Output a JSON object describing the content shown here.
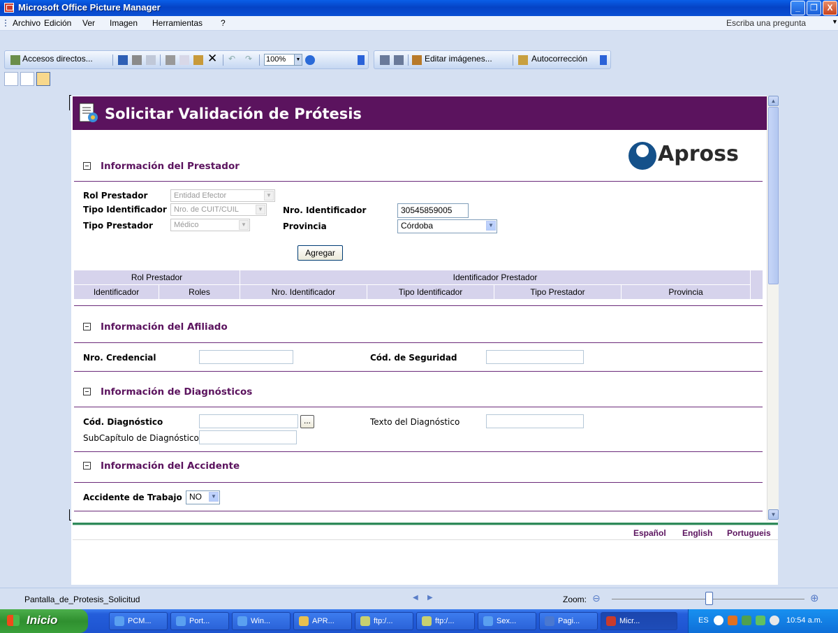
{
  "window": {
    "title": "Microsoft Office Picture Manager",
    "buttons": [
      "_",
      "❐",
      "X"
    ]
  },
  "menu": {
    "items": [
      "Archivo",
      "Edición",
      "Ver",
      "Imagen",
      "Herramientas",
      "?"
    ],
    "ask_placeholder": "Escriba una pregunta"
  },
  "toolbar": {
    "shortcuts_label": "Accesos directos...",
    "zoom_value": "100%",
    "edit_images_label": "Editar imágenes...",
    "autocorrect_label": "Autocorrección"
  },
  "form": {
    "title": "Solicitar Validación de Prótesis",
    "logo_text": "Apross",
    "sections": {
      "prestador": "Información del Prestador",
      "afiliado": "Información del Afiliado",
      "diagnosticos": "Información de Diagnósticos",
      "accidente": "Información del Accidente"
    },
    "prestador": {
      "rol_label": "Rol Prestador",
      "rol_value": "Entidad Efector",
      "tipo_id_label": "Tipo Identificador",
      "tipo_id_value": "Nro. de CUIT/CUIL",
      "tipo_prestador_label": "Tipo Prestador",
      "tipo_prestador_value": "Médico",
      "nro_id_label": "Nro. Identificador",
      "nro_id_value": "30545859005",
      "provincia_label": "Provincia",
      "provincia_value": "Córdoba",
      "add_button": "Agregar"
    },
    "grid": {
      "group_headers": [
        "Rol Prestador",
        "Identificador Prestador"
      ],
      "columns": [
        "Identificador",
        "Roles",
        "Nro. Identificador",
        "Tipo Identificador",
        "Tipo Prestador",
        "Provincia"
      ]
    },
    "afiliado": {
      "credencial_label": "Nro. Credencial",
      "credencial_value": "",
      "seguridad_label": "Cód. de Seguridad",
      "seguridad_value": ""
    },
    "diagnosticos": {
      "codigo_label": "Cód. Diagnóstico",
      "codigo_value": "",
      "browse_button": "...",
      "texto_label": "Texto del Diagnóstico",
      "texto_value": "",
      "subcap_label": "SubCapítulo de Diagnóstico",
      "subcap_value": ""
    },
    "accidente": {
      "trabajo_label": "Accidente de Trabajo",
      "trabajo_value": "NO"
    },
    "languages": [
      "Español",
      "English",
      "Portugueis"
    ]
  },
  "statusbar": {
    "filename": "Pantalla_de_Protesis_Solicitud",
    "zoom_label": "Zoom:",
    "zoom_slider_fraction": 0.5
  },
  "taskbar": {
    "start_label": "Inicio",
    "tasks": [
      "PCM...",
      "Port...",
      "Win...",
      "APR...",
      "ftp:/...",
      "ftp:/...",
      "Sex...",
      "Pagi...",
      "Micr..."
    ],
    "lang": "ES",
    "clock": "10:54 a.m."
  }
}
